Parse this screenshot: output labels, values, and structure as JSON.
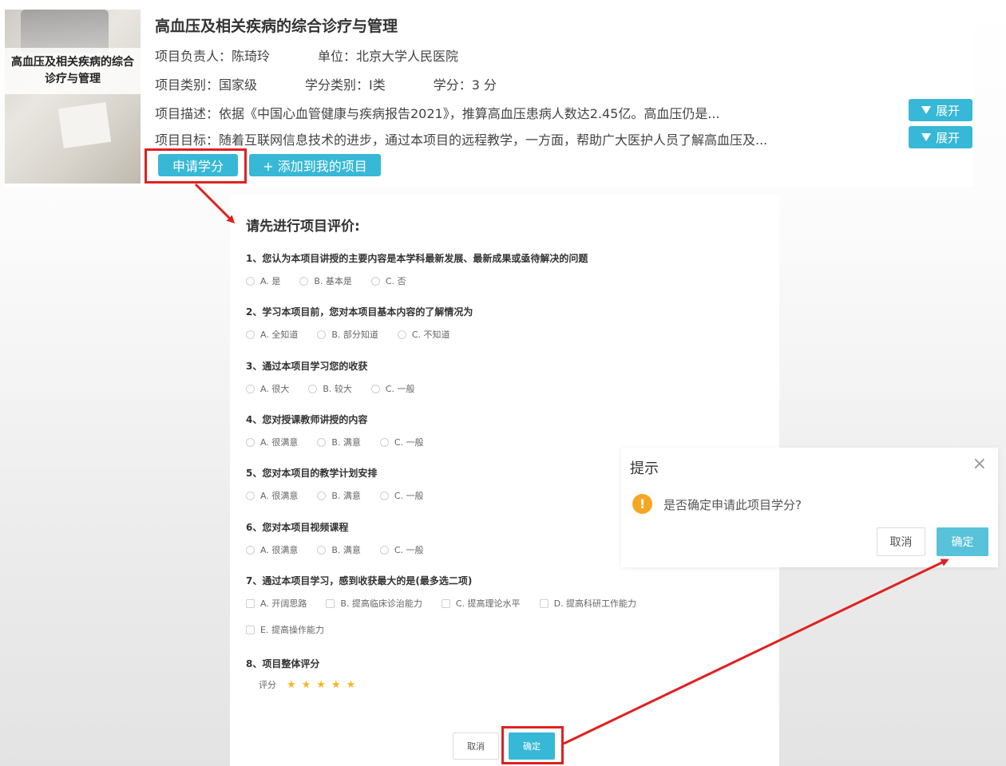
{
  "course": {
    "thumbnail_title": "高血压及相关疾病的综合诊疗与管理",
    "title": "高血压及相关疾病的综合诊疗与管理",
    "leader": "项目负责人：陈琦玲",
    "unit": "单位：北京大学人民医院",
    "category": "项目类别：国家级",
    "credit_type": "学分类别：I类",
    "credits": "学分：3 分",
    "description": "项目描述：依据《中国心血管健康与疾病报告2021》，推算高血压患病人数达2.45亿。高血压仍是...",
    "goal": "项目目标：随着互联网信息技术的进步，通过本项目的远程教学，一方面，帮助广大医护人员了解高血压及...",
    "expand_label": "展开",
    "apply_label": "申请学分",
    "add_label": "+ 添加到我的项目"
  },
  "evaluation": {
    "title": "请先进行项目评价:",
    "questions": [
      {
        "text": "1、您认为本项目讲授的主要内容是本学科最新发展、最新成果或亟待解决的问题",
        "options": [
          "A. 是",
          "B. 基本是",
          "C. 否"
        ]
      },
      {
        "text": "2、学习本项目前，您对本项目基本内容的了解情况为",
        "options": [
          "A. 全知道",
          "B. 部分知道",
          "C. 不知道"
        ]
      },
      {
        "text": "3、通过本项目学习您的收获",
        "options": [
          "A. 很大",
          "B. 较大",
          "C. 一般"
        ]
      },
      {
        "text": "4、您对授课教师讲授的内容",
        "options": [
          "A. 很满意",
          "B. 满意",
          "C. 一般"
        ]
      },
      {
        "text": "5、您对本项目的教学计划安排",
        "options": [
          "A. 很满意",
          "B. 满意",
          "C. 一般"
        ]
      },
      {
        "text": "6、您对本项目视频课程",
        "options": [
          "A. 很满意",
          "B. 满意",
          "C. 一般"
        ]
      },
      {
        "text": "7、通过本项目学习，感到收获最大的是(最多选二项)",
        "options": [
          "A. 开阔思路",
          "B. 提高临床诊治能力",
          "C. 提高理论水平",
          "D. 提高科研工作能力",
          "E. 提高操作能力"
        ]
      },
      {
        "text": "8、项目整体评分",
        "options": []
      }
    ],
    "rating_label": "评分",
    "rating_stars": 5,
    "cancel_label": "取消",
    "confirm_label": "确定"
  },
  "dialog": {
    "title": "提示",
    "close_glyph": "×",
    "warn_glyph": "!",
    "message": "是否确定申请此项目学分?",
    "cancel_label": "取消",
    "confirm_label": "确定"
  },
  "colors": {
    "accent": "#37b8d6",
    "highlight": "#e02020",
    "warning": "#f5a623",
    "star": "#f5b81b"
  }
}
